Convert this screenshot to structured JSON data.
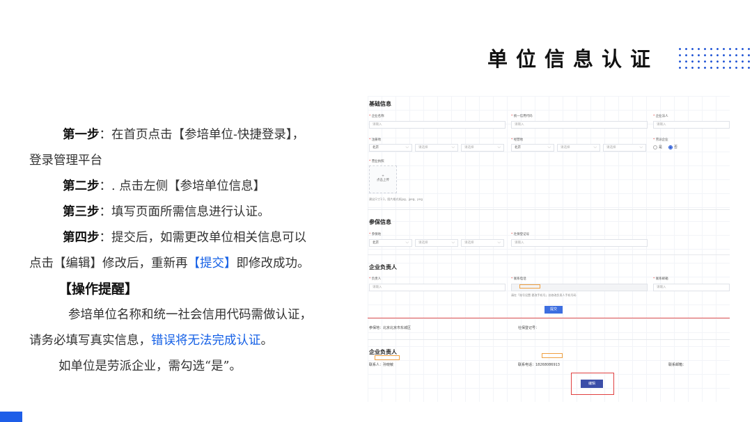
{
  "header": {
    "title": "单位信息认证"
  },
  "steps": {
    "step1_label": "第一步",
    "step1_line1": "：在首页点击【参培单位-快捷登录】，",
    "step1_line2": "登录管理平台",
    "step2_label": "第二步",
    "step2_text": "：. 点击左侧【参培单位信息】",
    "step3_label": "第三步",
    "step3_text": "：填写页面所需信息进行认证。",
    "step4_label": "第四步",
    "step4_line1": "：提交后，如需更改单位相关信息可以",
    "step4_line2_a": "点击【编辑】修改后，重新再",
    "step4_line2_submit": "【提交】",
    "step4_line2_b": "即修改成功。",
    "reminder_title": "【操作提醒】",
    "reminder_line1": "参培单位名称和统一社会信用代码需做认证，",
    "reminder_line2_a": "请务必填写真实信息，",
    "reminder_line2_warn": "错误将无法完成认证",
    "reminder_line2_b": "。",
    "reminder_line3": "如单位是劳派企业，需勾选“是”。"
  },
  "colors": {
    "accent": "#1e5ee8",
    "link_blue": "#1560e6",
    "highlight_red": "#e04040",
    "highlight_orange": "#f0a040"
  },
  "form": {
    "basic_title": "基础信息",
    "company_name_label": "企业名称",
    "credit_code_label": "统一信用代码",
    "legal_person_label": "企业法人",
    "placeholder": "请输入",
    "register_label": "注册地",
    "operate_label": "经营地",
    "labor_label": "劳派企业",
    "region_default": "北京",
    "select_placeholder": "请选择",
    "labor_yes": "是",
    "labor_no": "否",
    "license_label": "营业执照",
    "upload_plus": "+",
    "upload_text": "点击上传",
    "upload_hint": "建议尺寸1:1，图片格式如jpg、jpeg、png",
    "insurance_title": "参保信息",
    "insured_place_label": "参保地",
    "social_code_label": "社保登记号",
    "leader_title": "企业负责人",
    "leader_label": "负责人",
    "phone_label": "联系电话",
    "email_label": "联系邮箱",
    "phone_hint": "请在「账号设置-更改手机号」处修改负责人手机号码",
    "submit_button": "提交",
    "summary_place": "参保地：北京北京市东城区",
    "summary_code": "社保登记号：",
    "summary_leader_title": "企业负责人",
    "summary_contact": "联系人：孙晓敏",
    "summary_phone": "联系电话：18268086913",
    "summary_email": "联系邮箱：",
    "edit_button": "编辑"
  }
}
